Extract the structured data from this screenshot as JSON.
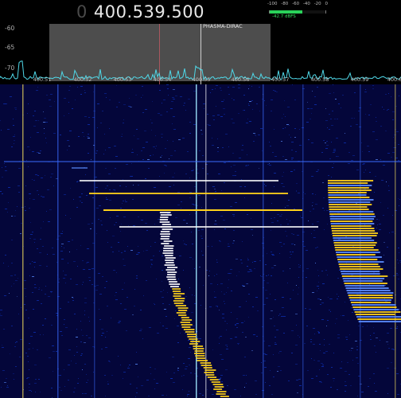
{
  "header": {
    "freq_prefix": "0",
    "freq_value": "400.539.500"
  },
  "meter": {
    "scale": [
      "-100",
      "-80",
      "-60",
      "-40",
      "-20",
      "0"
    ],
    "reading": "-42.7 dBFS",
    "level_fraction": 0.58,
    "color": "#2ad35a"
  },
  "spectrum": {
    "db_labels": [
      "-60",
      "-65",
      "-70"
    ],
    "vfo_name": "PHASMA-DIRAC",
    "freq_ticks": [
      "400.51",
      "400.52",
      "400.53",
      "400.54",
      "400.55",
      "400.56",
      "400.57",
      "400.58",
      "400.59",
      "400.6"
    ],
    "colors": {
      "filter": "#aaaaaa",
      "trace": "#4fd8e8",
      "center_marker": "#c05a64"
    }
  },
  "waterfall": {
    "colors": {
      "background": "#04063a",
      "noise": "#0d2fb0",
      "signal_low": "#5a8cff",
      "signal_mid": "#ffffff",
      "signal_high": "#ffd21a"
    }
  }
}
